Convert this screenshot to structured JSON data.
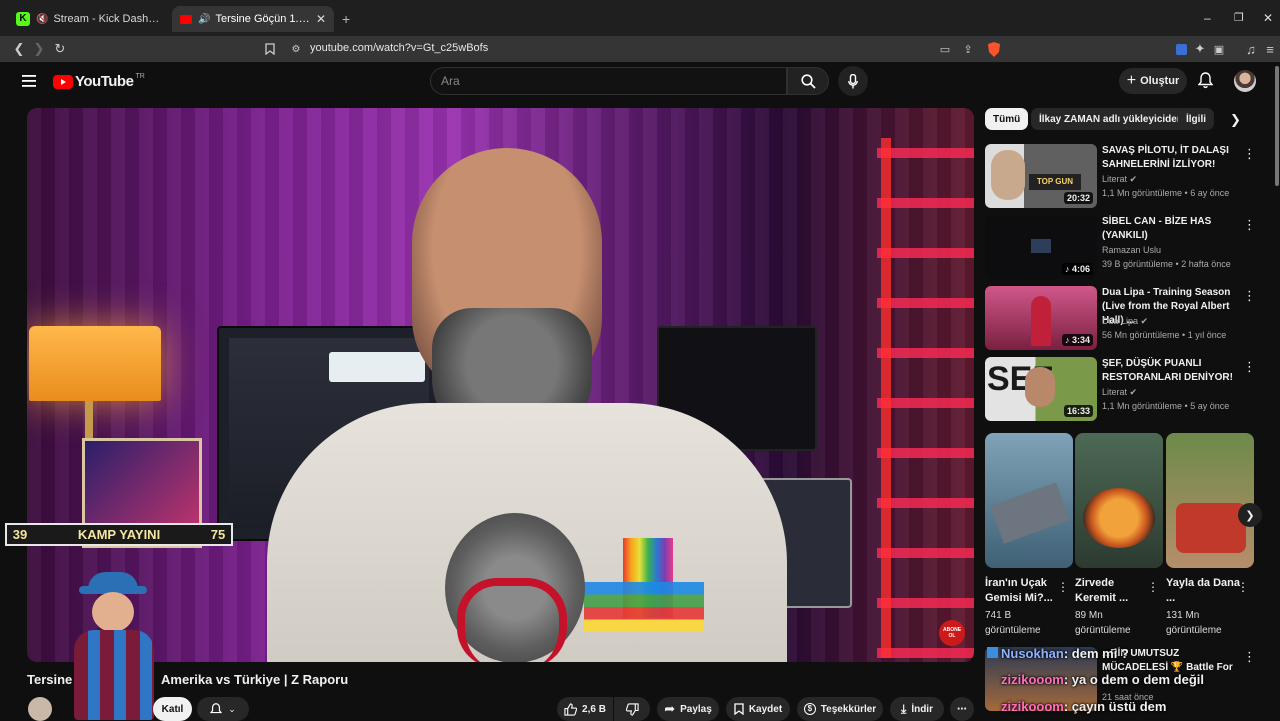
{
  "tabs": [
    {
      "title": "Stream - Kick Dashboard"
    },
    {
      "title": "Tersine Göçün 1. Yılı | Amerika"
    }
  ],
  "address_bar": {
    "url": "youtube.com/watch?v=Gt_c25wBofs"
  },
  "header": {
    "logo_text": "YouTube",
    "logo_region": "TR",
    "search_placeholder": "Ara",
    "create_label": "Oluştur"
  },
  "overlay": {
    "left_number": "39",
    "banner_text": "KAMP YAYINI",
    "right_number": "75"
  },
  "video": {
    "title_prefix": "Tersine",
    "title_suffix": "Amerika vs Türkiye | Z Raporu",
    "join_label": "Katıl",
    "like_count": "2,6 B",
    "share_label": "Paylaş",
    "save_label": "Kaydet",
    "thanks_label": "Teşekkürler",
    "download_label": "İndir",
    "corner_badge": "ABONE OL"
  },
  "chips": [
    "Tümü",
    "İlkay ZAMAN adlı yükleyiciden",
    "İlgili"
  ],
  "recommendations": [
    {
      "title": "SAVAŞ PİLOTU, İT DALAŞI SAHNELERİNİ İZLİYOR!",
      "channel": "Literat",
      "verified": true,
      "meta": "1,1 Mn görüntüleme • 6 ay önce",
      "duration": "20:32"
    },
    {
      "title": "SİBEL CAN - BİZE HAS (YANKILI)",
      "channel": "Ramazan Uslu",
      "verified": false,
      "meta": "39 B görüntüleme • 2 hafta önce",
      "duration": "4:06"
    },
    {
      "title": "Dua Lipa - Training Season (Live from the Royal Albert Hall) ...",
      "channel": "Dua Lipa",
      "verified": true,
      "meta": "56 Mn görüntüleme • 1 yıl önce",
      "duration": "3:34"
    },
    {
      "title": "ŞEF, DÜŞÜK PUANLI RESTORANLARI DENİYOR!",
      "channel": "Literat",
      "verified": true,
      "meta": "1,1 Mn görüntüleme • 5 ay önce",
      "duration": "16:33"
    }
  ],
  "shorts": [
    {
      "title": "İran'ın Uçak Gemisi Mi?...",
      "views": "741 B görüntüleme"
    },
    {
      "title": "Zirvede Keremit ...",
      "views": "89 Mn görüntüleme"
    },
    {
      "title": "Yayla da Dana ...",
      "views": "131 Mn görüntüleme"
    }
  ],
  "bottom_rec": {
    "title": "...RİN UMUTSUZ MÜCADELESİ 🏆 Battle For ...",
    "meta": "21 saat önce"
  },
  "chat": [
    {
      "user": "Nusokhan",
      "message": "dem mi ?"
    },
    {
      "user": "zizikooom",
      "message": "ya o dem o dem değil"
    },
    {
      "user": "zizikooom",
      "message": "çayın üstü dem"
    }
  ],
  "colors": {
    "youtube_red": "#ff0000",
    "kick_green": "#53fc18",
    "banner_bg": "#1a1a1a"
  }
}
